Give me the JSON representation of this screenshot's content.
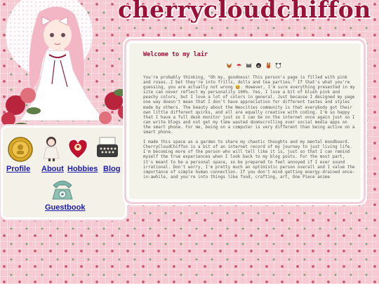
{
  "site": {
    "title": "cherrycloudchiffon"
  },
  "nav": {
    "items": [
      {
        "key": "profile",
        "label": "Profile",
        "icon": "gold-coin-icon"
      },
      {
        "key": "about",
        "label": "About",
        "icon": "doll-icon"
      },
      {
        "key": "hobbies",
        "label": "Hobbies",
        "icon": "heart-pin-icon"
      },
      {
        "key": "blog",
        "label": "Blog",
        "icon": "typewriter-icon"
      },
      {
        "key": "guestbook",
        "label": "Guestbook",
        "icon": "telephone-icon"
      }
    ]
  },
  "content": {
    "heading": "Welcome to my lair",
    "badges": [
      "fox-icon",
      "mushroom-icon",
      "cat-icon",
      "dog-icon",
      "bunny-icon",
      "panda-icon"
    ],
    "paragraph1": "You're probably thinking, \"Oh my, goodness! This person's page is filled with pink and roses..I bet they're into frills, dolls and tea parties.\" If that's what you're guessing, you are actually not wrong 😆. However, I'm sure everything presented in my site can never reflect my personality 100%. Yes, I love a bit of blush pink and peachy colors, but I love a lot of colors in general. Just because I designed my page one way doesn't mean that I don't have appreciation for different tastes and styles made by others. The beauty about the Neocities community is that everybody got their own little different quirks, and all are equally creative with coding. I'm so happy that I have a full desk monitor just so I can be on the internet once again just so I can write blogs and not get my time wasted doomscrolling over social media apps on the smart phone. For me, being on a computer is very different than being active on a smart phone.",
    "paragraph2": "I made this space as a garden to share my chaotic thoughts and my mental moodboard. CherryCloudChiffon is a bit of an internet record of my journey to just living life. I'm becoming more of the person who will tell like it is, just so that I can remind myself the true experiences when I look back to my blog posts. For the most part, it's meant to be a personal space, so be prepared to feel annoyed if I ever sound irrational. Don't worry, I'm pretty much an optimistic person overall and I value the importance of simple human connection. If you don't mind getting energy-drained once-in-awhile, and you're into things like food, crafting, art, One Piece anime"
  },
  "colors": {
    "title": "#9b1036",
    "link": "#1a1aa8",
    "background": "#f6c9d3",
    "panel": "#f4f1e8"
  }
}
